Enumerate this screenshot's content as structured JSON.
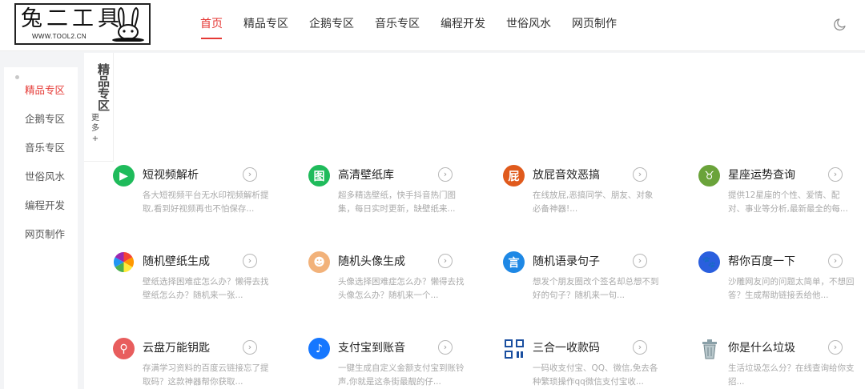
{
  "logo": {
    "text": "兔二工具",
    "url": "WWW.TOOL2.CN"
  },
  "nav": [
    "首页",
    "精品专区",
    "企鹅专区",
    "音乐专区",
    "编程开发",
    "世俗风水",
    "网页制作"
  ],
  "sidebar": [
    "精品专区",
    "企鹅专区",
    "音乐专区",
    "世俗风水",
    "编程开发",
    "网页制作"
  ],
  "section": {
    "title": "精品专区",
    "more": "更多+"
  },
  "arrow_glyph": "›",
  "cards": [
    {
      "title": "短视频解析",
      "desc": "各大短视频平台无水印视频解析提取,看到好视频再也不怕保存...",
      "icon": "video-play-icon",
      "color": "#1fbb5b",
      "glyph": "▶"
    },
    {
      "title": "高清壁纸库",
      "desc": "超多精选壁纸，快手抖音热门图集，每日实时更新，缺壁纸来...",
      "icon": "picture-icon",
      "color": "#1fbb5b",
      "glyph": "图"
    },
    {
      "title": "放屁音效恶搞",
      "desc": "在线放屁,恶搞同学、朋友、对象必备神器!...",
      "icon": "fart-icon",
      "color": "#e05a1c",
      "glyph": "屁"
    },
    {
      "title": "星座运势查询",
      "desc": "提供12星座的个性、爱情、配对、事业等分析,最新最全的每...",
      "icon": "zodiac-icon",
      "color": "#6aa33a",
      "glyph": "♉"
    },
    {
      "title": "随机壁纸生成",
      "desc": "壁纸选择困难症怎么办？懒得去找壁纸怎么办？随机来一张...",
      "icon": "color-wheel-icon",
      "color": "#ffffff",
      "glyph": ""
    },
    {
      "title": "随机头像生成",
      "desc": "头像选择困难症怎么办？懒得去找头像怎么办？随机来一个...",
      "icon": "avatar-icon",
      "color": "#f2b27a",
      "glyph": "☻"
    },
    {
      "title": "随机语录句子",
      "desc": "想发个朋友圈改个签名却总想不到好的句子？随机来一句...",
      "icon": "quote-icon",
      "color": "#1e88e5",
      "glyph": "言"
    },
    {
      "title": "帮你百度一下",
      "desc": "沙雕网友问的问题太简单，不想回答？生成帮助链接丢给他...",
      "icon": "baidu-paw-icon",
      "color": "#2a5fde",
      "glyph": "🐾"
    },
    {
      "title": "云盘万能钥匙",
      "desc": "存满学习资料的百度云链接忘了提取码？这款神器帮你获取...",
      "icon": "key-icon",
      "color": "#e85d5d",
      "glyph": "⚲"
    },
    {
      "title": "支付宝到账音",
      "desc": "一键生成自定义金额支付宝到账铃声,你就是这条街最靓的仔...",
      "icon": "alipay-sound-icon",
      "color": "#1677ff",
      "glyph": "♪"
    },
    {
      "title": "三合一收款码",
      "desc": "一码收支付宝、QQ、微信,免去各种繁琐操作qq微信支付宝收...",
      "icon": "qrcode-icon",
      "color": "#ffffff",
      "glyph": ""
    },
    {
      "title": "你是什么垃圾",
      "desc": "生活垃圾怎么分？在线查询给你支招...",
      "icon": "trash-bin-icon",
      "color": "#ffffff",
      "glyph": ""
    }
  ]
}
